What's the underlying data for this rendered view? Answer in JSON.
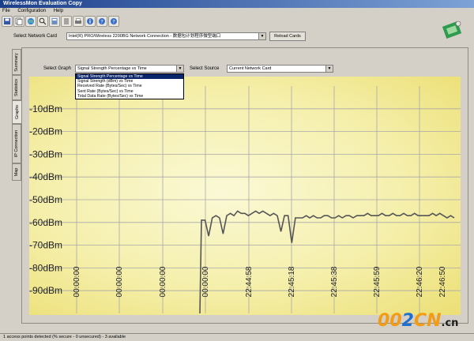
{
  "window": {
    "title": "WirelessMon Evaluation Copy"
  },
  "menu": [
    "File",
    "Configuration",
    "Help"
  ],
  "toolbar": {
    "icons": [
      "save-icon",
      "copy-icon",
      "globe-icon",
      "search-icon",
      "book-icon",
      "list-icon",
      "print-icon",
      "info-icon",
      "help-icon",
      "help-icon"
    ]
  },
  "network_card": {
    "label": "Select Network Card",
    "value": "Intel(R) PRO/Wireless 2200BG Network Connection - 数据包计划程序微型端口",
    "reload_label": "Reload Cards"
  },
  "side_tabs": [
    "Summary",
    "Statistics",
    "Graphs",
    "IP Connection",
    "Map"
  ],
  "active_tab": "Graphs",
  "graph": {
    "select_label": "Select Graph",
    "select_value": "Signal Strength Percentage vs Time",
    "options": [
      "Signal Strength Percentage vs Time",
      "Signal Strength (dBm) vs Time",
      "Received Rate (Bytes/Sec) vs Time",
      "Sent Rate (Bytes/Sec) vs Time",
      "Total Data Rate (Bytes/Sec) vs Time"
    ],
    "selected_option_index": 0
  },
  "source": {
    "label": "Select Source",
    "value": "Current Network Card"
  },
  "chart_data": {
    "type": "line",
    "ylabel": "",
    "xlabel": "",
    "y_unit": "dBm",
    "y_ticks": [
      "-10dBm",
      "-20dBm",
      "-30dBm",
      "-40dBm",
      "-50dBm",
      "-60dBm",
      "-70dBm",
      "-80dBm",
      "-90dBm"
    ],
    "y_tick_values": [
      -10,
      -20,
      -30,
      -40,
      -50,
      -60,
      -70,
      -80,
      -90
    ],
    "x_ticks": [
      "00:00:00",
      "00:00:00",
      "00:00:00",
      "00:00:00",
      "22:44:58",
      "22:45:18",
      "22:45:38",
      "22:45:59",
      "22:46:20",
      "22:46:50"
    ],
    "ylim": [
      -100,
      0
    ],
    "grid": true,
    "series": [
      {
        "color": "#555555",
        "x": [
          0,
          1,
          2,
          3,
          4,
          5,
          6,
          7,
          8,
          9,
          10,
          11,
          12,
          13,
          14,
          15,
          16,
          17,
          18,
          19,
          20,
          21,
          22,
          23,
          24,
          25,
          26,
          27,
          28,
          29,
          30,
          31,
          32,
          33,
          34,
          35,
          36,
          37,
          38,
          39,
          40,
          41,
          42,
          43,
          44,
          45,
          46,
          47,
          48,
          49,
          50,
          51,
          52,
          53,
          54,
          55,
          56,
          57,
          58,
          59,
          60,
          61,
          62,
          63,
          64,
          65,
          66,
          67,
          68,
          69,
          70,
          71
        ],
        "y": [
          -100,
          -59,
          -59,
          -66,
          -58,
          -57,
          -58,
          -65,
          -57,
          -56,
          -57,
          -55,
          -56,
          -56,
          -57,
          -56,
          -55,
          -56,
          -55,
          -56,
          -57,
          -56,
          -57,
          -64,
          -57,
          -57,
          -69,
          -58,
          -58,
          -58,
          -57,
          -58,
          -57,
          -58,
          -58,
          -57,
          -57,
          -58,
          -58,
          -57,
          -58,
          -57,
          -57,
          -58,
          -57,
          -57,
          -57,
          -56,
          -57,
          -57,
          -57,
          -56,
          -57,
          -57,
          -56,
          -57,
          -57,
          -56,
          -57,
          -57,
          -56,
          -57,
          -57,
          -57,
          -57,
          -56,
          -57,
          -56,
          -57,
          -58,
          -57,
          -58
        ]
      }
    ]
  },
  "status": {
    "text": "1 access points detected (% secure - 0 unsecured) - 3 available"
  },
  "watermark": {
    "main": "002CN",
    "suffix": ".cn"
  },
  "colors": {
    "titlebar": "#1c3f8c",
    "plot_bg": "#f5efab",
    "selection": "#0a246a",
    "line": "#555555"
  }
}
